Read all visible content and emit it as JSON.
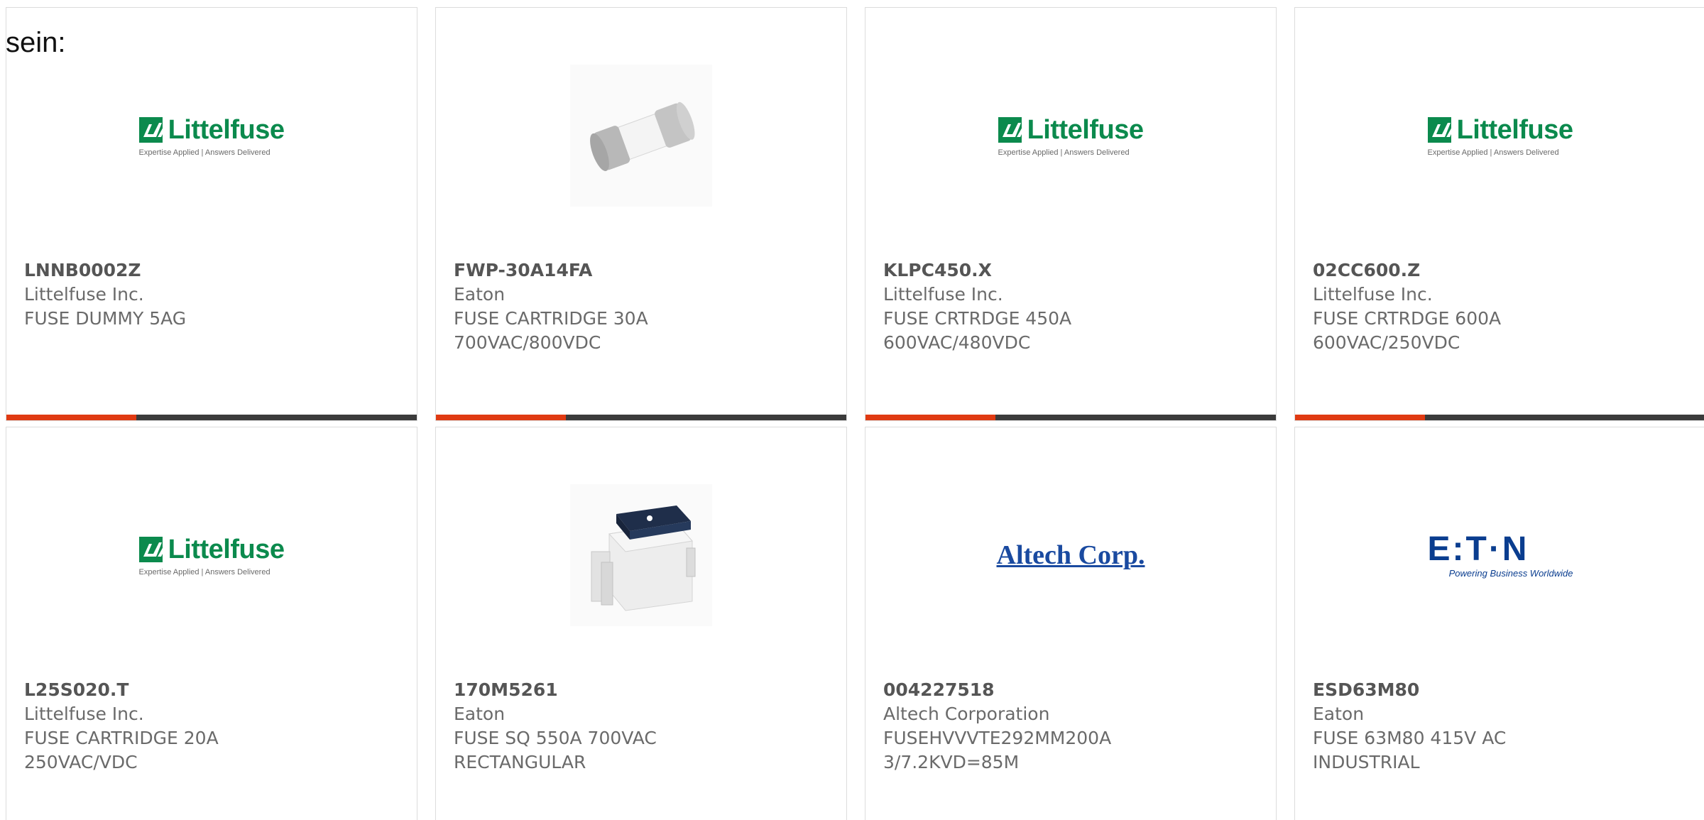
{
  "intro_text": "sein:",
  "products": [
    {
      "part": "LNNB0002Z",
      "mfr": "Littelfuse Inc.",
      "desc": "FUSE DUMMY 5AG",
      "image": "littelfuse-logo"
    },
    {
      "part": "FWP-30A14FA",
      "mfr": "Eaton",
      "desc": "FUSE CARTRIDGE 30A 700VAC/800VDC",
      "image": "cartridge-fuse-photo"
    },
    {
      "part": "KLPC450.X",
      "mfr": "Littelfuse Inc.",
      "desc": "FUSE CRTRDGE 450A 600VAC/480VDC",
      "image": "littelfuse-logo"
    },
    {
      "part": "02CC600.Z",
      "mfr": "Littelfuse Inc.",
      "desc": "FUSE CRTRDGE 600A 600VAC/250VDC",
      "image": "littelfuse-logo"
    },
    {
      "part": "L25S020.T",
      "mfr": "Littelfuse Inc.",
      "desc": "FUSE CARTRIDGE 20A 250VAC/VDC",
      "image": "littelfuse-logo"
    },
    {
      "part": "170M5261",
      "mfr": "Eaton",
      "desc": "FUSE SQ 550A 700VAC RECTANGULAR",
      "image": "square-fuse-photo"
    },
    {
      "part": "004227518",
      "mfr": "Altech Corporation",
      "desc": "FUSEHVVVTE292MM200A 3/7.2KVD=85M",
      "image": "altech-logo"
    },
    {
      "part": "ESD63M80",
      "mfr": "Eaton",
      "desc": "FUSE 63M80 415V AC INDUSTRIAL",
      "image": "eaton-logo"
    }
  ],
  "logos": {
    "littelfuse": {
      "name": "Littelfuse",
      "tagline": "Expertise Applied  |  Answers Delivered"
    },
    "altech": {
      "name": "Altech Corp."
    },
    "eaton": {
      "name": "E:T·N",
      "tagline": "Powering Business Worldwide"
    }
  },
  "colors": {
    "accent": "#e03a12",
    "bar": "#3b3b3b",
    "littelfuse_green": "#0b8a4d",
    "altech_blue": "#1a4aa0",
    "eaton_blue": "#0a3d8f"
  }
}
